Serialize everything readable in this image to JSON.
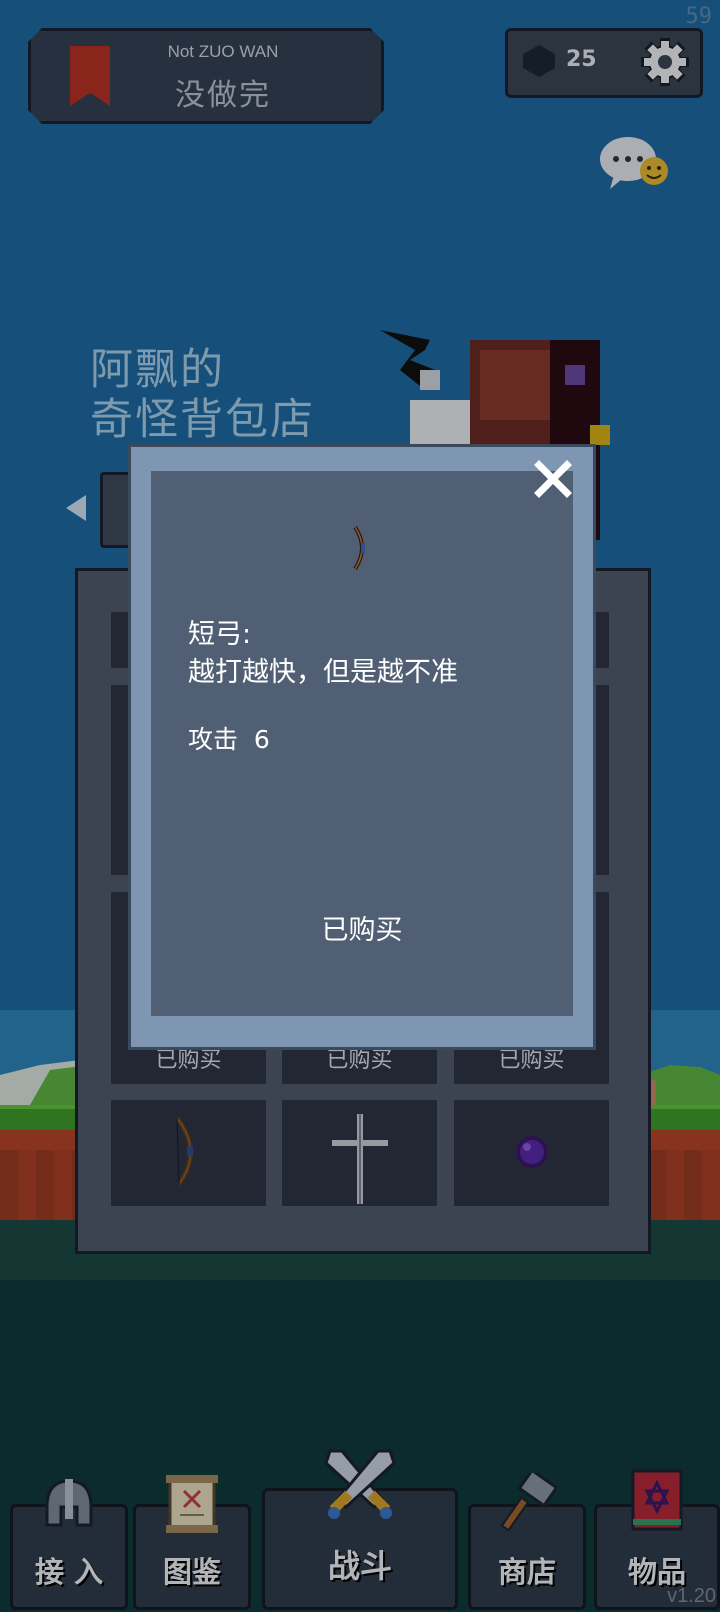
{
  "fps": "59",
  "header": {
    "title_en": "Not ZUO WAN",
    "title_cn": "没做完",
    "gems": "25"
  },
  "shop": {
    "name_line1": "阿飘的",
    "name_line2": "奇怪背包店",
    "slot_status": "已购买"
  },
  "modal": {
    "item_name": "短弓:",
    "item_desc": "越打越快，但是越不准",
    "stat_label": "攻击",
    "stat_value": "6",
    "status": "已购买"
  },
  "nav": {
    "items": [
      {
        "label": "接 入",
        "icon": "helmet-icon"
      },
      {
        "label": "图鉴",
        "icon": "scroll-icon"
      },
      {
        "label": "战斗",
        "icon": "crossed-swords-icon"
      },
      {
        "label": "商店",
        "icon": "hammer-icon"
      },
      {
        "label": "物品",
        "icon": "spellbook-icon"
      }
    ]
  },
  "version": "v1.20",
  "colors": {
    "sky": "#1d6aa3",
    "panel": "#4f5b6b",
    "modal_border": "#7f96b3",
    "modal_fill": "#505f73",
    "accent_red": "#b83226"
  }
}
